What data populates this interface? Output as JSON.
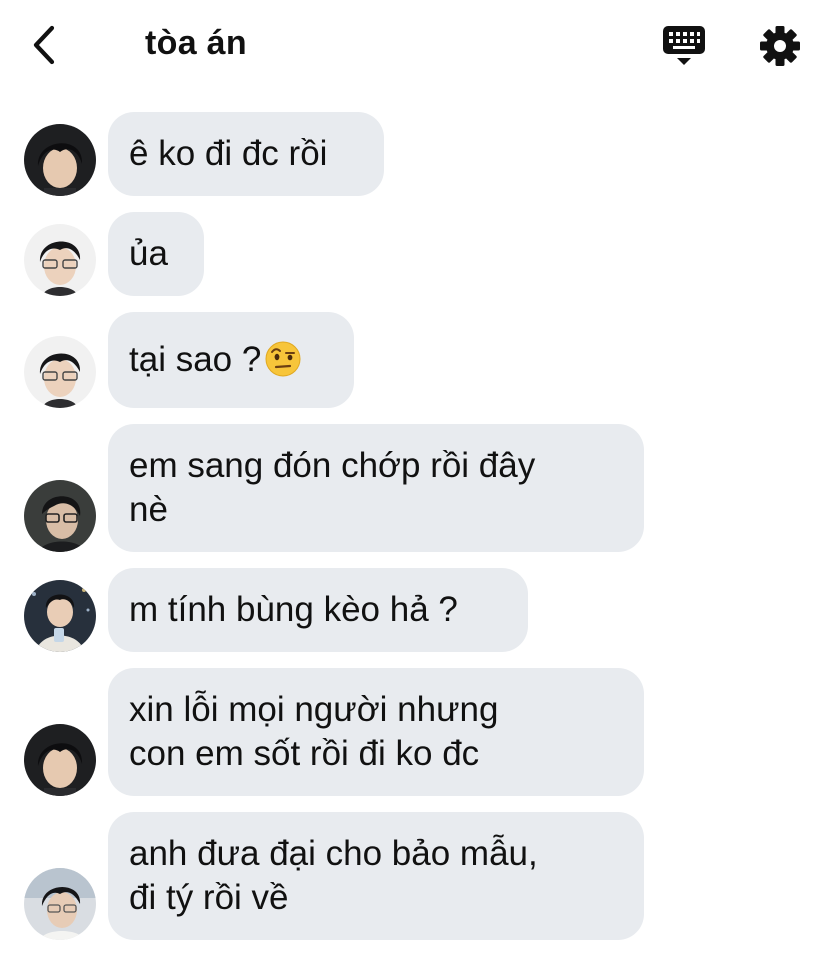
{
  "header": {
    "title": "tòa án",
    "back_icon": "chevron-left-icon",
    "keyboard_icon": "keyboard-icon",
    "settings_icon": "gear-icon"
  },
  "messages": [
    {
      "text": "ê ko đi đc rồi"
    },
    {
      "text": "ủa"
    },
    {
      "text": "tại sao ?",
      "emoji": "face-with-raised-eyebrow"
    },
    {
      "text": "em sang đón chớp rồi đây\nnè"
    },
    {
      "text": "m tính bùng kèo hả ?"
    },
    {
      "text": "xin lỗi mọi người nhưng\ncon em sốt rồi đi ko đc"
    },
    {
      "text": "anh đưa đại cho bảo mẫu,\nđi tý rồi về"
    }
  ],
  "colors": {
    "bubble": "#e8ebef",
    "text": "#111111",
    "background": "#ffffff"
  }
}
